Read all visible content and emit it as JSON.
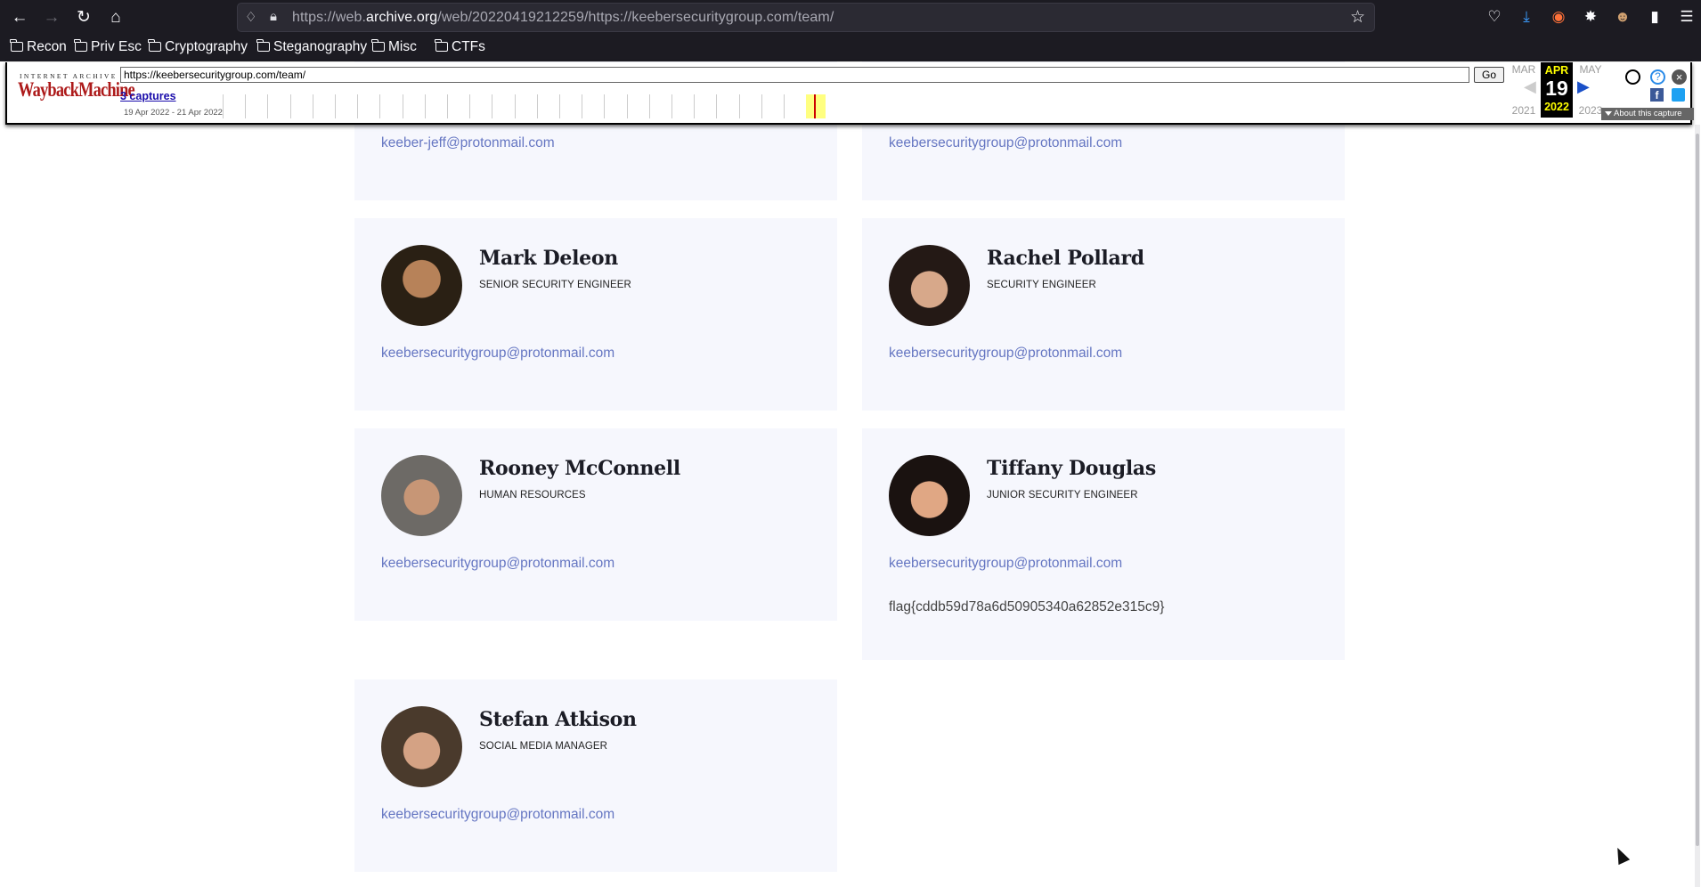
{
  "browser": {
    "url_prefix": "https://web.",
    "url_domain": "archive.org",
    "url_rest": "/web/20220419212259/https://keebersecuritygroup.com/team/",
    "bookmarks": [
      "Recon",
      "Priv Esc",
      "Cryptography",
      "Steganography",
      "Misc",
      "CTFs"
    ]
  },
  "wayback": {
    "logo_top": "INTERNET ARCHIVE",
    "logo_main": "WaybackMachine",
    "url_value": "https://keebersecuritygroup.com/team/",
    "go_label": "Go",
    "captures": "3 captures",
    "date_range": "19 Apr 2022 - 21 Apr 2022",
    "prev_month": "MAR",
    "cur_month": "APR",
    "next_month": "MAY",
    "cur_day": "19",
    "prev_year": "2021",
    "cur_year": "2022",
    "next_year": "2023",
    "about": "About this capture"
  },
  "team": {
    "top_left_email": "keeber-jeff@protonmail.com",
    "top_right_email": "keebersecuritygroup@protonmail.com",
    "members": [
      {
        "name": "Mark Deleon",
        "role": "SENIOR SECURITY ENGINEER",
        "email": "keebersecuritygroup@protonmail.com"
      },
      {
        "name": "Rachel Pollard",
        "role": "SECURITY ENGINEER",
        "email": "keebersecuritygroup@protonmail.com"
      },
      {
        "name": "Rooney McConnell",
        "role": "HUMAN RESOURCES",
        "email": "keebersecuritygroup@protonmail.com"
      },
      {
        "name": "Tiffany Douglas",
        "role": "JUNIOR SECURITY ENGINEER",
        "email": "keebersecuritygroup@protonmail.com",
        "flag": "flag{cddb59d78a6d50905340a62852e315c9}"
      },
      {
        "name": "Stefan Atkison",
        "role": "SOCIAL MEDIA MANAGER",
        "email": "keebersecuritygroup@protonmail.com"
      }
    ]
  },
  "colors": {
    "accent": "#6576c2",
    "card_bg": "#f6f7fd",
    "browser_bg": "#1c1b22"
  }
}
